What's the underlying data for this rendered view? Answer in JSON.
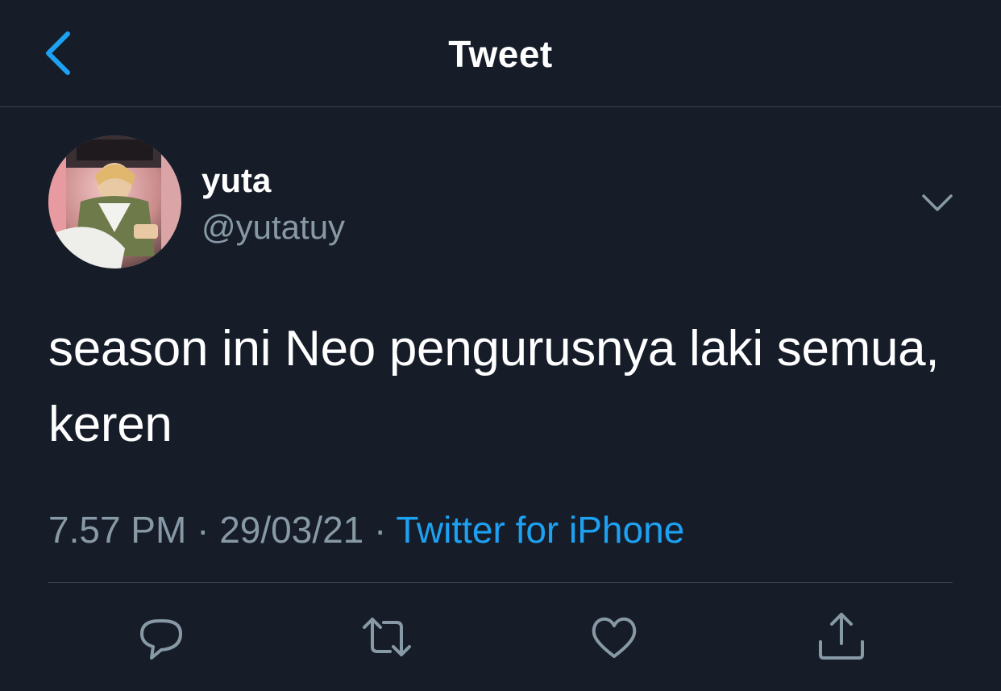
{
  "header": {
    "title": "Tweet",
    "back_icon": "chevron-left-icon"
  },
  "tweet": {
    "author": {
      "display_name": "yuta",
      "handle": "@yutatuy"
    },
    "text": "season ini Neo pengurusnya laki semua, keren",
    "time": "7.57 PM",
    "date": "29/03/21",
    "separator": "·",
    "source": "Twitter for iPhone"
  },
  "actions": [
    {
      "name": "reply",
      "icon": "reply-icon"
    },
    {
      "name": "retweet",
      "icon": "retweet-icon"
    },
    {
      "name": "like",
      "icon": "heart-icon"
    },
    {
      "name": "share",
      "icon": "share-icon"
    }
  ],
  "colors": {
    "background": "#161d29",
    "accent": "#1da1f2",
    "secondary_text": "#8899a6",
    "divider": "#38444d"
  }
}
